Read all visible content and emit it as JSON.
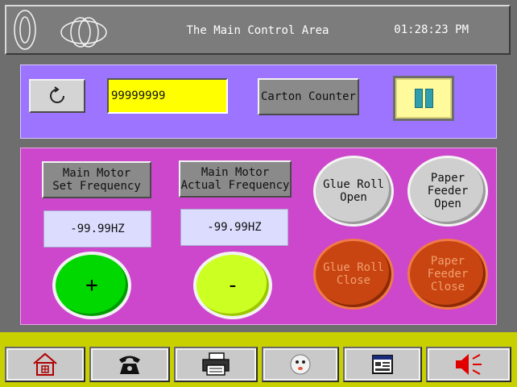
{
  "header": {
    "title": "The Main Control Area",
    "time": "01:28:23 PM"
  },
  "counter": {
    "reset_icon": "refresh-icon",
    "value": "99999999",
    "label": "Carton Counter",
    "pause_icon": "pause-icon"
  },
  "motor": {
    "set_label_line1": "Main Motor",
    "set_label_line2": "Set Frequency",
    "actual_label_line1": "Main Motor",
    "actual_label_line2": "Actual Frequency",
    "set_value": "-99.99HZ",
    "actual_value": "-99.99HZ",
    "increase_label": "+",
    "decrease_label": "-"
  },
  "buttons": {
    "glue_open_line1": "Glue Roll",
    "glue_open_line2": "Open",
    "glue_close_line1": "Glue Roll",
    "glue_close_line2": "Close",
    "feeder_open_line1": "Paper",
    "feeder_open_line2": "Feeder",
    "feeder_open_line3": "Open",
    "feeder_close_line1": "Paper",
    "feeder_close_line2": "Feeder",
    "feeder_close_line3": "Close"
  },
  "nav": {
    "items": [
      {
        "icon": "home-icon"
      },
      {
        "icon": "telephone-icon"
      },
      {
        "icon": "printer-icon"
      },
      {
        "icon": "face-icon"
      },
      {
        "icon": "window-icon"
      },
      {
        "icon": "speaker-icon"
      }
    ]
  },
  "colors": {
    "top_panel": "#9d74ff",
    "main_panel": "#cc47cc",
    "counter_field": "#ffff00",
    "increase_button": "#00d800",
    "decrease_button": "#ccff22",
    "close_buttons": "#c84411",
    "nav_bar": "#c8d000"
  }
}
